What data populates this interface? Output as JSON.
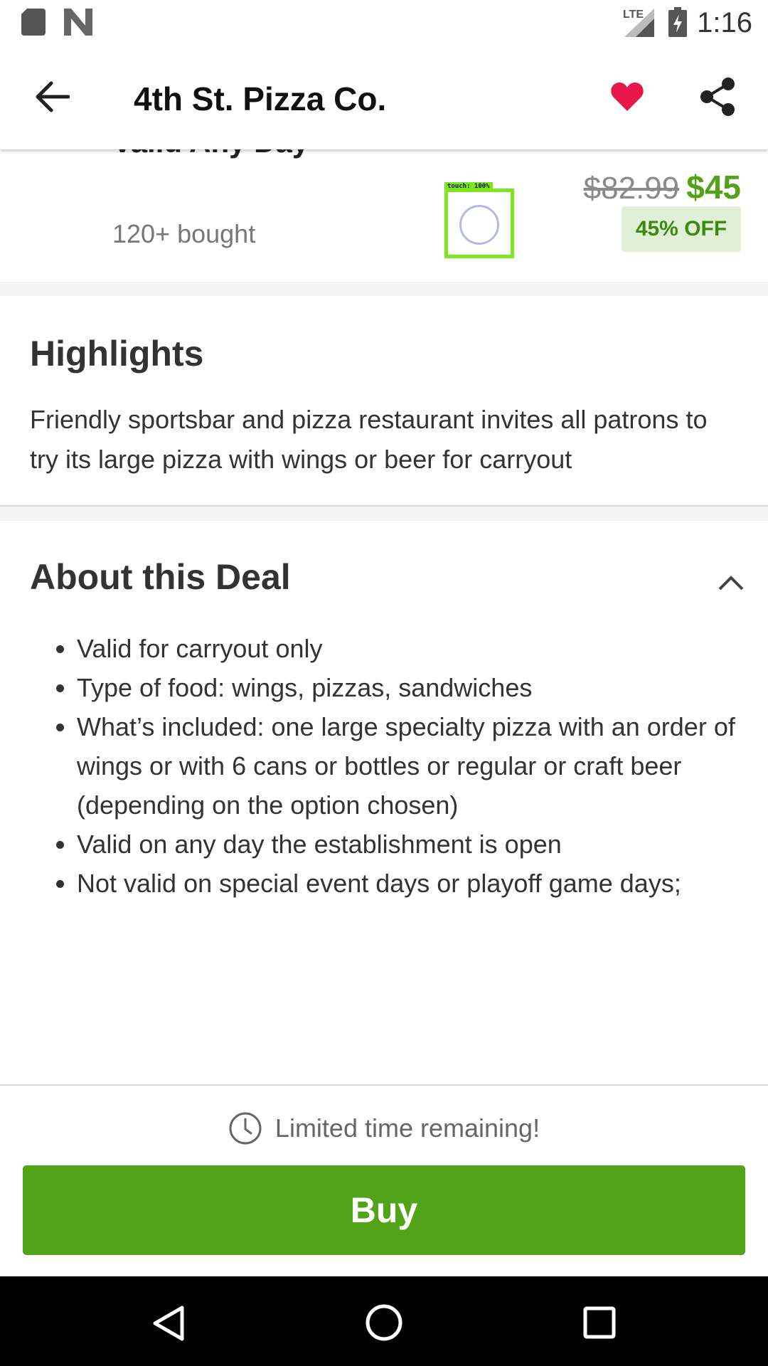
{
  "status_bar": {
    "time": "1:16",
    "icons": [
      "sd-card-icon",
      "n-notification-icon",
      "lte-signal-icon",
      "battery-charging-icon"
    ],
    "network_label": "LTE"
  },
  "app_bar": {
    "title": "4th St. Pizza Co.",
    "icons": [
      "back-arrow-icon",
      "heart-icon",
      "share-icon"
    ],
    "heart_color": "#e8174b"
  },
  "deal": {
    "subtitle": "Valid Any Day",
    "bought": "120+ bought",
    "old_price": "$82.99",
    "new_price": "$45",
    "discount": "45% OFF",
    "accent_color": "#53a318"
  },
  "touch_indicator": {
    "label": "touch: 100%"
  },
  "highlights": {
    "title": "Highlights",
    "text": "Friendly sportsbar and pizza restaurant invites all patrons to try its large pizza with wings or beer for carryout"
  },
  "about": {
    "title": "About this Deal",
    "items": [
      "Valid for carryout only",
      "Type of food: wings, pizzas, sandwiches",
      "What’s included: one large specialty pizza with an order of wings or with 6 cans or bottles or regular or craft beer (depending on the option chosen)",
      "Valid on any day the establishment is open",
      "Not valid on special event days or playoff game days;"
    ]
  },
  "bottom_bar": {
    "limited_text": "Limited time remaining!",
    "buy_label": "Buy"
  },
  "nav_bar": {
    "icons": [
      "back-triangle-icon",
      "home-circle-icon",
      "recents-square-icon"
    ]
  }
}
